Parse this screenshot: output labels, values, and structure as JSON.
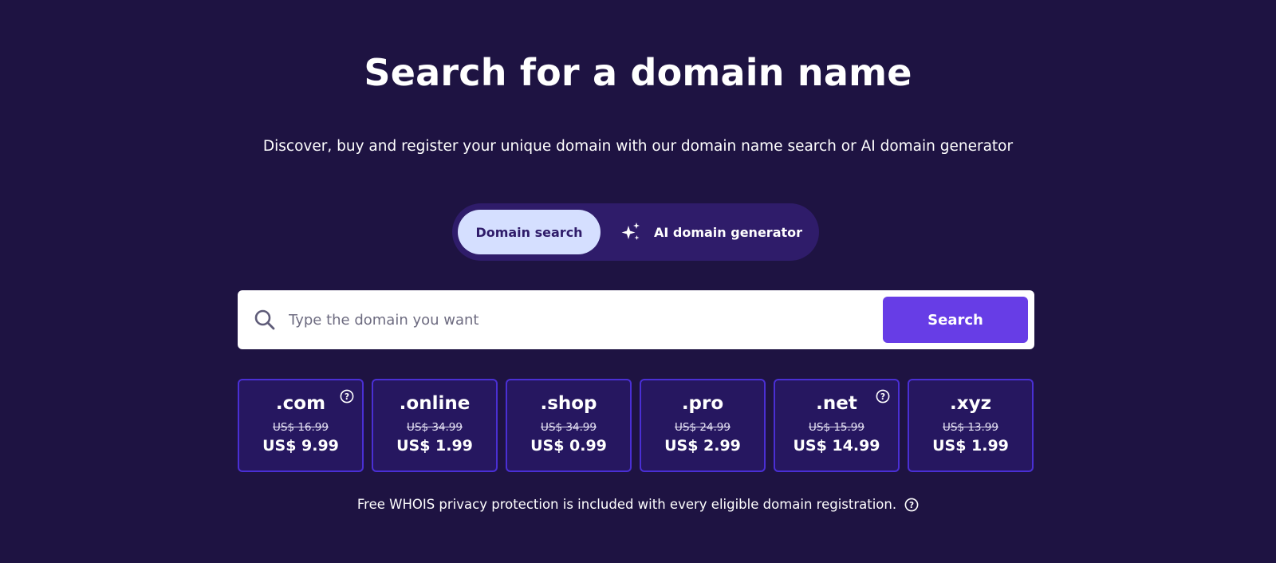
{
  "header": {
    "title": "Search for a domain name",
    "subtitle": "Discover, buy and register your unique domain with our domain name search or AI domain generator"
  },
  "toggle": {
    "domain_search_label": "Domain search",
    "ai_generator_label": "AI domain generator",
    "ai_icon": "sparkle-icon"
  },
  "search": {
    "placeholder": "Type the domain you want",
    "value": "",
    "button_label": "Search",
    "icon": "search-icon"
  },
  "tlds": [
    {
      "name": ".com",
      "old_price": "US$ 16.99",
      "price": "US$ 9.99",
      "has_help": true
    },
    {
      "name": ".online",
      "old_price": "US$ 34.99",
      "price": "US$ 1.99",
      "has_help": false
    },
    {
      "name": ".shop",
      "old_price": "US$ 34.99",
      "price": "US$ 0.99",
      "has_help": false
    },
    {
      "name": ".pro",
      "old_price": "US$ 24.99",
      "price": "US$ 2.99",
      "has_help": false
    },
    {
      "name": ".net",
      "old_price": "US$ 15.99",
      "price": "US$ 14.99",
      "has_help": true
    },
    {
      "name": ".xyz",
      "old_price": "US$ 13.99",
      "price": "US$ 1.99",
      "has_help": false
    }
  ],
  "footer": {
    "note": "Free WHOIS privacy protection is included with every eligible domain registration.",
    "icon": "help-icon"
  },
  "colors": {
    "background": "#1e1342",
    "accent": "#673de6",
    "toggle_active": "#d5dfff",
    "card_border": "#4a2fd4"
  }
}
